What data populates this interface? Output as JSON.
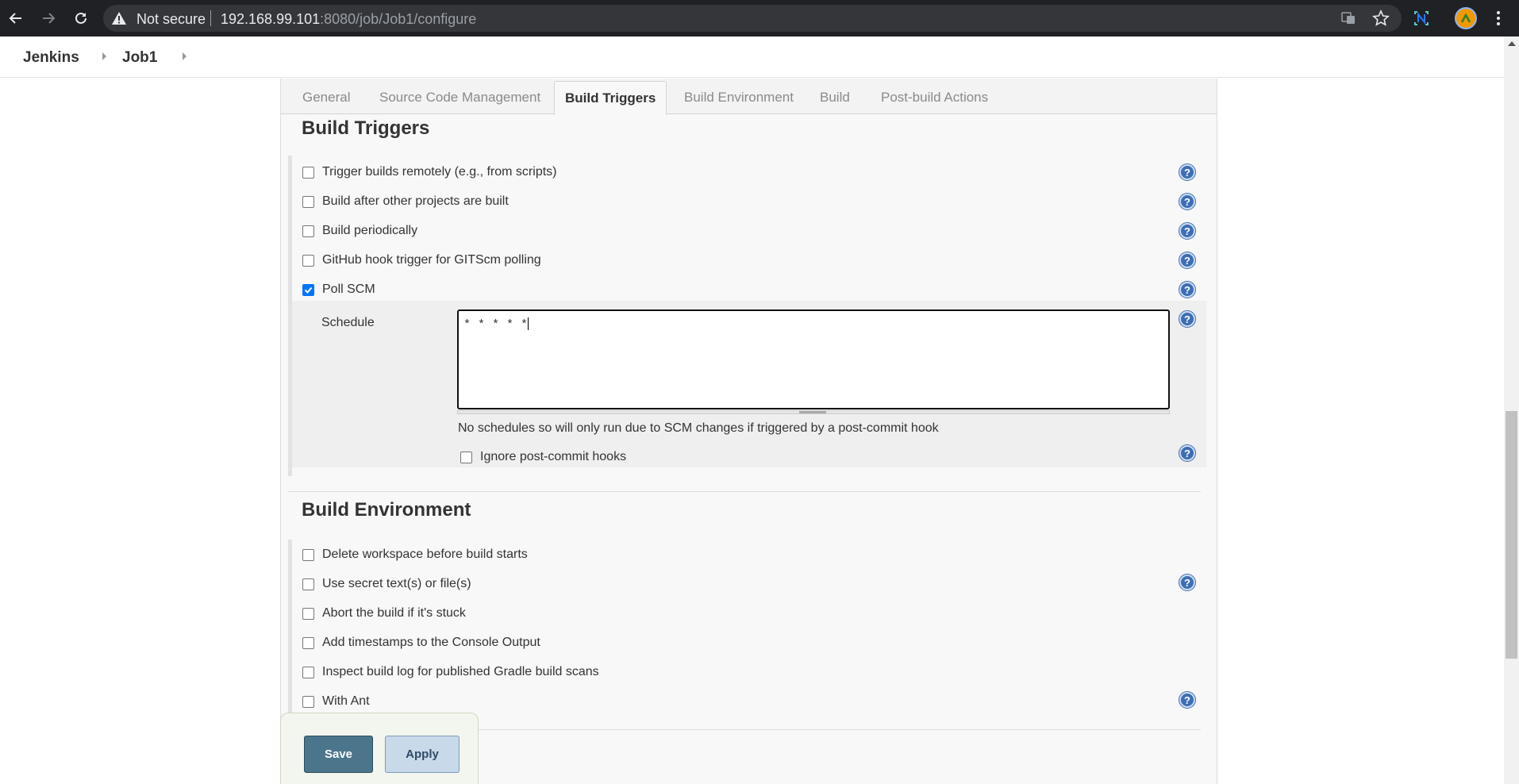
{
  "browser": {
    "security_label": "Not secure",
    "url_host": "192.168.99.101",
    "url_path": ":8080/job/Job1/configure"
  },
  "breadcrumb": {
    "items": [
      "Jenkins",
      "Job1"
    ]
  },
  "tabs": [
    "General",
    "Source Code Management",
    "Build Triggers",
    "Build Environment",
    "Build",
    "Post-build Actions"
  ],
  "active_tab": "Build Triggers",
  "build_triggers": {
    "title": "Build Triggers",
    "options": [
      {
        "label": "Trigger builds remotely (e.g., from scripts)",
        "checked": false
      },
      {
        "label": "Build after other projects are built",
        "checked": false
      },
      {
        "label": "Build periodically",
        "checked": false
      },
      {
        "label": "GitHub hook trigger for GITScm polling",
        "checked": false
      },
      {
        "label": "Poll SCM",
        "checked": true
      }
    ],
    "schedule_label": "Schedule",
    "schedule_value": "* * * * *",
    "schedule_hint": "No schedules so will only run due to SCM changes if triggered by a post-commit hook",
    "ignore_hooks_label": "Ignore post-commit hooks"
  },
  "build_environment": {
    "title": "Build Environment",
    "options": [
      {
        "label": "Delete workspace before build starts",
        "checked": false
      },
      {
        "label": "Use secret text(s) or file(s)",
        "checked": false
      },
      {
        "label": "Abort the build if it's stuck",
        "checked": false
      },
      {
        "label": "Add timestamps to the Console Output",
        "checked": false
      },
      {
        "label": "Inspect build log for published Gradle build scans",
        "checked": false
      },
      {
        "label": "With Ant",
        "checked": false
      }
    ]
  },
  "buttons": {
    "save": "Save",
    "apply": "Apply"
  },
  "help_glyph": "?",
  "colors": {
    "checkbox_checked": "#0075ff",
    "help_icon": "#3d6eb4",
    "save_button": "#4b758b",
    "apply_button": "#c8d9ea"
  }
}
